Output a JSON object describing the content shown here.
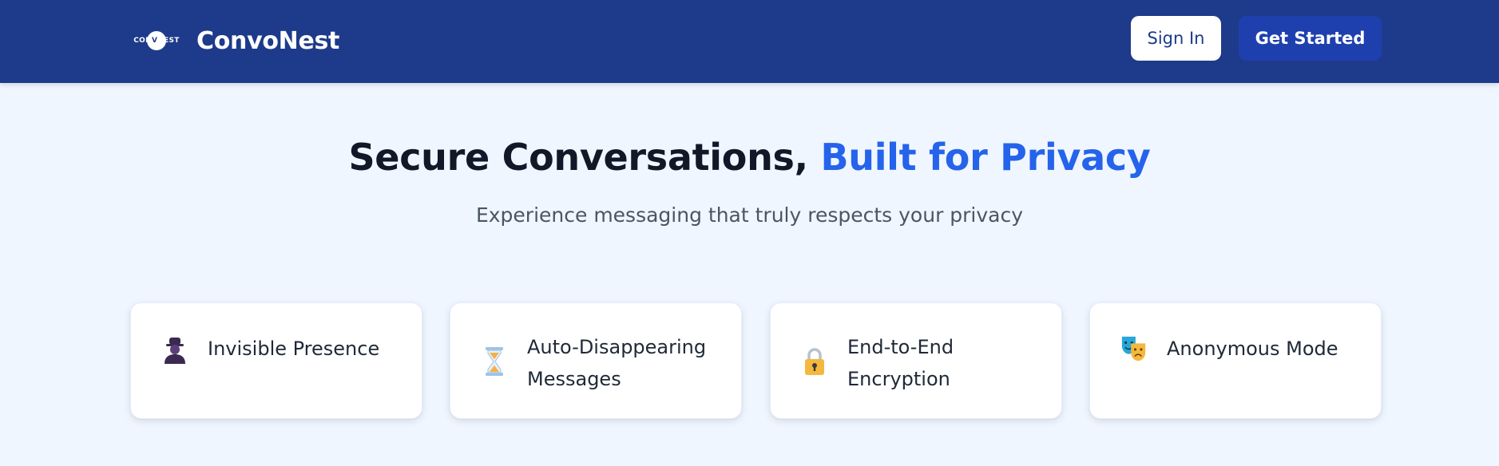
{
  "header": {
    "logo_text_left": "CON",
    "logo_text_mid": "V",
    "logo_text_right": "NEST",
    "brand_name": "ConvoNest",
    "sign_in_label": "Sign In",
    "get_started_label": "Get Started"
  },
  "hero": {
    "title_main": "Secure Conversations, ",
    "title_accent": "Built for Privacy",
    "subtitle": "Experience messaging that truly respects your privacy"
  },
  "features": [
    {
      "title": "Invisible Presence",
      "icon": "incognito-person-icon"
    },
    {
      "title": "Auto-Disappearing Messages",
      "icon": "hourglass-icon"
    },
    {
      "title": "End-to-End Encryption",
      "icon": "lock-icon"
    },
    {
      "title": "Anonymous Mode",
      "icon": "theater-masks-icon"
    }
  ],
  "colors": {
    "header_bg": "#1e3a8a",
    "primary_button": "#1e40af",
    "accent_text": "#2563eb",
    "page_bg": "#eff6ff"
  }
}
